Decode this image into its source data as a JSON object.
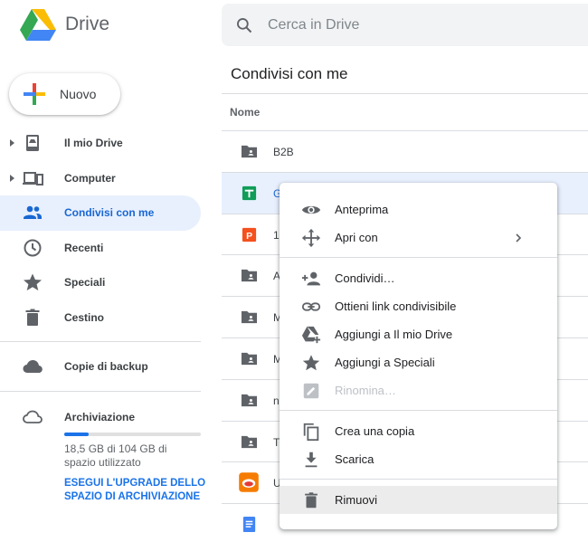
{
  "header": {
    "brand": "Drive",
    "search_placeholder": "Cerca in Drive"
  },
  "sidebar": {
    "new_label": "Nuovo",
    "items": [
      {
        "label": "Il mio Drive",
        "icon": "my-drive-icon",
        "expandable": true
      },
      {
        "label": "Computer",
        "icon": "computer-icon",
        "expandable": true
      },
      {
        "label": "Condivisi con me",
        "icon": "shared-icon",
        "active": true
      },
      {
        "label": "Recenti",
        "icon": "clock-icon"
      },
      {
        "label": "Speciali",
        "icon": "star-icon"
      },
      {
        "label": "Cestino",
        "icon": "trash-icon"
      }
    ],
    "backup_label": "Copie di backup",
    "storage": {
      "title": "Archiviazione",
      "used_fraction": 0.18,
      "text": "18,5 GB di 104 GB di spazio utilizzato",
      "upgrade": "ESEGUI L'UPGRADE DELLO SPAZIO DI ARCHIVIAZIONE"
    }
  },
  "main": {
    "title": "Condivisi con me",
    "column_name": "Nome",
    "rows": [
      {
        "name": "B2B",
        "icon": "shared-folder-icon"
      },
      {
        "name": "G",
        "icon": "sheets-icon",
        "selected": true
      },
      {
        "name": "1",
        "icon": "slides-icon"
      },
      {
        "name": "A",
        "icon": "shared-folder-icon"
      },
      {
        "name": "M",
        "icon": "shared-folder-icon"
      },
      {
        "name": "M",
        "icon": "shared-folder-icon"
      },
      {
        "name": "n",
        "icon": "shared-folder-icon"
      },
      {
        "name": "T",
        "icon": "shared-folder-icon"
      },
      {
        "name": "U",
        "icon": "image-icon"
      },
      {
        "name": "",
        "icon": "docs-icon"
      }
    ]
  },
  "context_menu": {
    "groups": [
      [
        {
          "label": "Anteprima",
          "icon": "eye-icon"
        },
        {
          "label": "Apri con",
          "icon": "move-icon",
          "submenu": true
        }
      ],
      [
        {
          "label": "Condividi…",
          "icon": "add-person-icon"
        },
        {
          "label": "Ottieni link condivisibile",
          "icon": "link-icon"
        },
        {
          "label": "Aggiungi a Il mio Drive",
          "icon": "add-to-drive-icon"
        },
        {
          "label": "Aggiungi a Speciali",
          "icon": "star-icon"
        },
        {
          "label": "Rinomina…",
          "icon": "rename-icon",
          "disabled": true
        }
      ],
      [
        {
          "label": "Crea una copia",
          "icon": "copy-icon"
        },
        {
          "label": "Scarica",
          "icon": "download-icon"
        }
      ],
      [
        {
          "label": "Rimuovi",
          "icon": "trash-icon",
          "hover": true
        }
      ]
    ]
  }
}
